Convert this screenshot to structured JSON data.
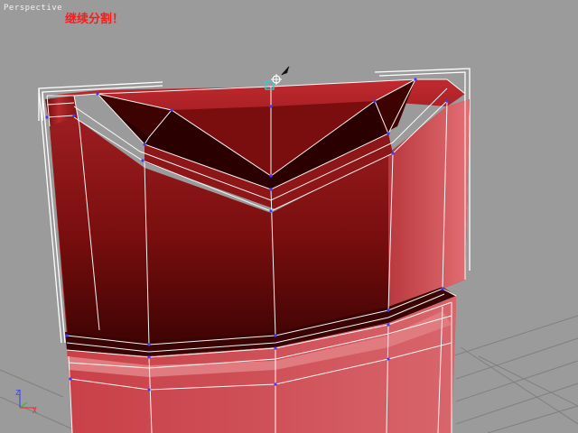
{
  "viewport": {
    "label": "Perspective",
    "instruction": "继续分割！",
    "colors": {
      "background": "#9b9b9b",
      "grid": "#7f7f7f",
      "mesh_dark": "#3a0303",
      "mesh_mid": "#8e1717",
      "mesh_light": "#d0575c",
      "edges": "#ffffff",
      "selection_box": "#ffffff",
      "vertices": "#3c3cff",
      "annotation_text": "#ff1a1a"
    },
    "icons": [
      "move-gizmo-icon",
      "mouse-cursor-icon",
      "axis-tripod-icon"
    ],
    "axis_labels": [
      "Z",
      "X"
    ]
  }
}
